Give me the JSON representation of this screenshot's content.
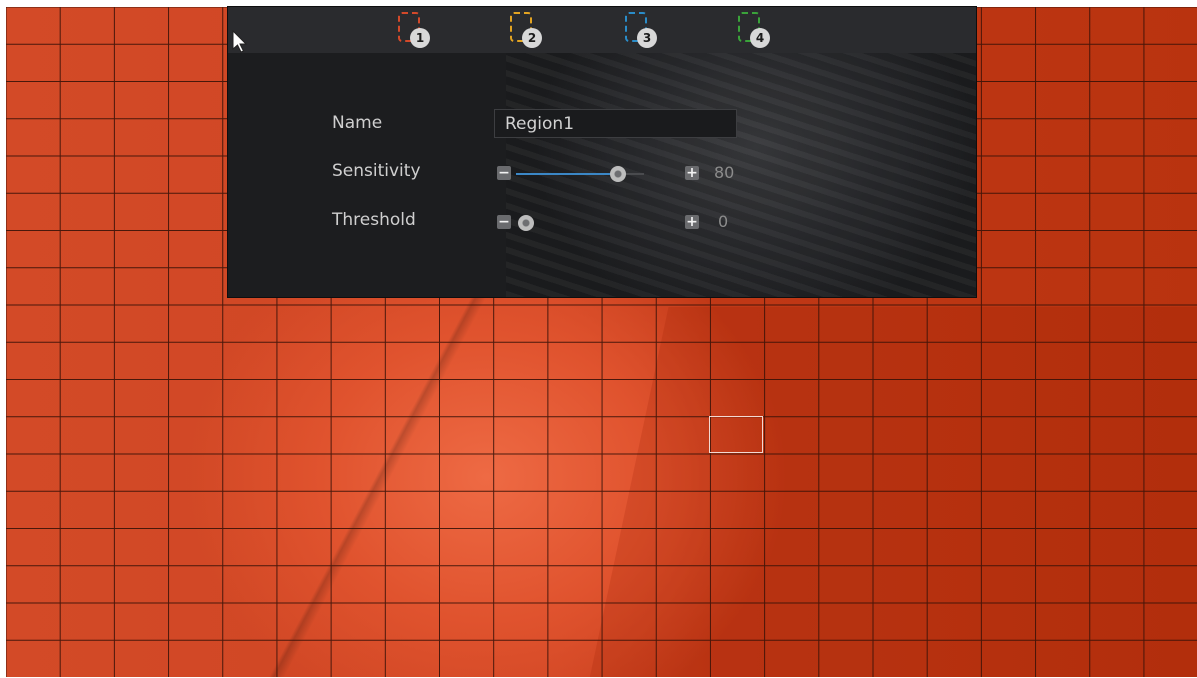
{
  "colors": {
    "region1": "#d2492a",
    "region2": "#e3a422",
    "region3": "#2a8cc8",
    "region4": "#3aa33a",
    "slider_fill": "#3b87c6",
    "overlay": "#cf4523"
  },
  "tabs": [
    {
      "number": "1",
      "color": "#d2492a"
    },
    {
      "number": "2",
      "color": "#e3a422"
    },
    {
      "number": "3",
      "color": "#2a8cc8"
    },
    {
      "number": "4",
      "color": "#3aa33a"
    }
  ],
  "form": {
    "name_label": "Name",
    "name_value": "Region1",
    "sensitivity_label": "Sensitivity",
    "sensitivity_value": "80",
    "sensitivity_min_icon": "minus-icon",
    "sensitivity_max_icon": "plus-icon",
    "threshold_label": "Threshold",
    "threshold_value": "0",
    "minus_glyph": "−",
    "plus_glyph": "+"
  },
  "sliders": {
    "sensitivity_level": 0.8,
    "threshold_level": 0.0
  }
}
